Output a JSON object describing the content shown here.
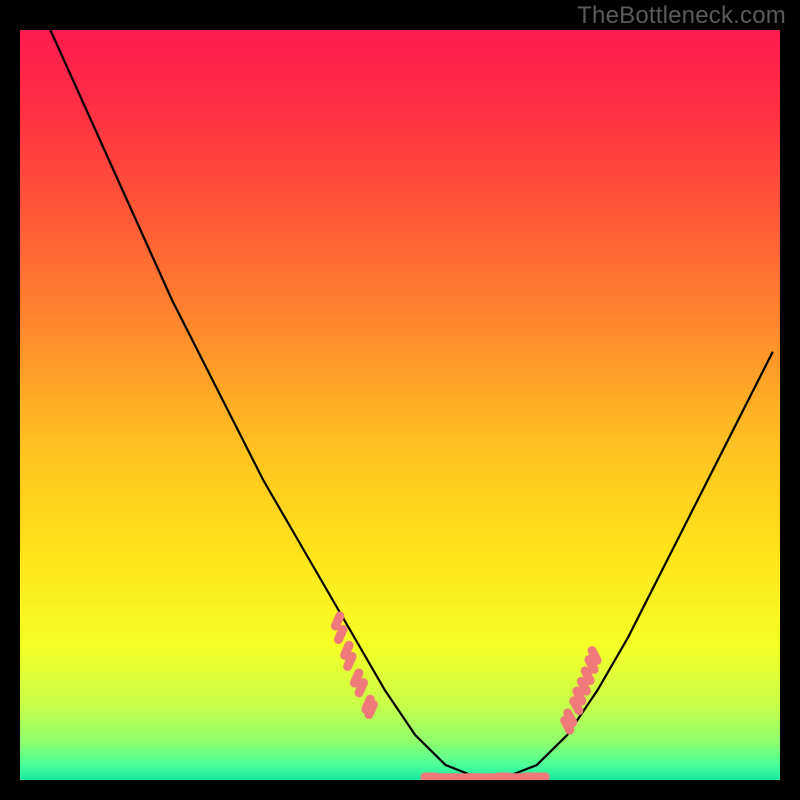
{
  "attribution": "TheBottleneck.com",
  "colors": {
    "frame": "#000000",
    "gradient_stops": [
      {
        "offset": 0.0,
        "color": "#ff1a50"
      },
      {
        "offset": 0.1,
        "color": "#ff2e44"
      },
      {
        "offset": 0.25,
        "color": "#ff5936"
      },
      {
        "offset": 0.4,
        "color": "#ff8a2d"
      },
      {
        "offset": 0.55,
        "color": "#ffc021"
      },
      {
        "offset": 0.7,
        "color": "#ffe41a"
      },
      {
        "offset": 0.82,
        "color": "#f6ff25"
      },
      {
        "offset": 0.9,
        "color": "#c9ff4a"
      },
      {
        "offset": 0.95,
        "color": "#8dff6e"
      },
      {
        "offset": 0.98,
        "color": "#4bff9a"
      },
      {
        "offset": 1.0,
        "color": "#17e8a0"
      }
    ],
    "curve": "#000000",
    "dots": "#f07a7a"
  },
  "chart_data": {
    "type": "line",
    "title": "",
    "xlabel": "",
    "ylabel": "",
    "xlim": [
      0,
      1
    ],
    "ylim": [
      0,
      1
    ],
    "series": [
      {
        "name": "bottleneck-curve",
        "x": [
          0.04,
          0.08,
          0.12,
          0.16,
          0.2,
          0.24,
          0.28,
          0.32,
          0.36,
          0.4,
          0.44,
          0.48,
          0.52,
          0.56,
          0.6,
          0.64,
          0.68,
          0.72,
          0.76,
          0.8,
          0.84,
          0.88,
          0.92,
          0.96,
          0.99
        ],
        "y": [
          1.0,
          0.91,
          0.82,
          0.73,
          0.64,
          0.56,
          0.48,
          0.4,
          0.33,
          0.26,
          0.19,
          0.12,
          0.06,
          0.02,
          0.004,
          0.004,
          0.02,
          0.06,
          0.12,
          0.19,
          0.27,
          0.35,
          0.43,
          0.51,
          0.57
        ]
      }
    ],
    "dot_clusters": [
      {
        "name": "left-cluster",
        "points": [
          [
            0.418,
            0.212
          ],
          [
            0.422,
            0.194
          ],
          [
            0.43,
            0.173
          ],
          [
            0.434,
            0.158
          ],
          [
            0.443,
            0.136
          ],
          [
            0.449,
            0.123
          ],
          [
            0.458,
            0.101
          ],
          [
            0.462,
            0.094
          ]
        ]
      },
      {
        "name": "bottom-cluster",
        "points": [
          [
            0.54,
            0.004
          ],
          [
            0.558,
            0.003
          ],
          [
            0.575,
            0.003
          ],
          [
            0.594,
            0.003
          ],
          [
            0.6,
            0.003
          ],
          [
            0.618,
            0.003
          ],
          [
            0.636,
            0.004
          ],
          [
            0.653,
            0.003
          ],
          [
            0.672,
            0.004
          ],
          [
            0.684,
            0.004
          ]
        ]
      },
      {
        "name": "right-cluster",
        "points": [
          [
            0.72,
            0.073
          ],
          [
            0.724,
            0.083
          ],
          [
            0.732,
            0.099
          ],
          [
            0.736,
            0.112
          ],
          [
            0.742,
            0.125
          ],
          [
            0.747,
            0.139
          ],
          [
            0.752,
            0.154
          ],
          [
            0.756,
            0.166
          ]
        ]
      }
    ]
  }
}
